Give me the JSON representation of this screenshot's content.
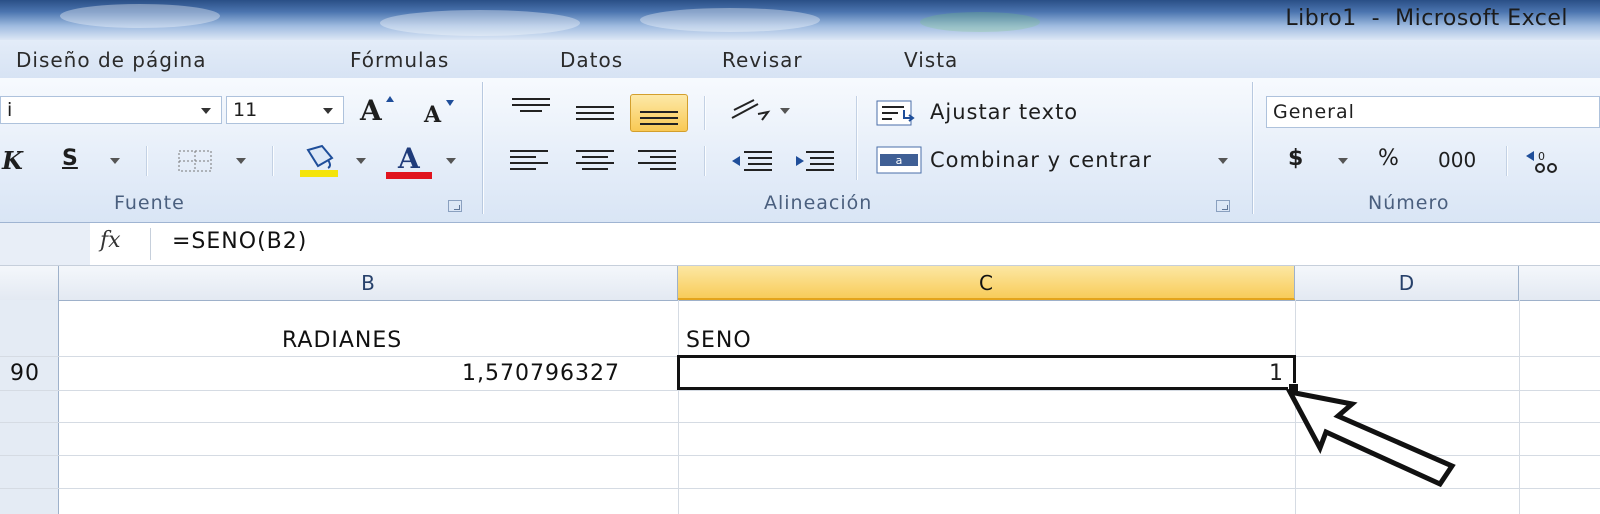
{
  "window": {
    "title": "Libro1  -  Microsoft Excel"
  },
  "tabs": [
    "Diseño de página",
    "Fórmulas",
    "Datos",
    "Revisar",
    "Vista"
  ],
  "ribbon": {
    "font_group": {
      "label": "Fuente",
      "font_name_partial": "i",
      "font_size": "11",
      "grow_label": "A",
      "shrink_label": "A",
      "italic_partial": "K",
      "underline_label": "S",
      "font_color_label": "A",
      "highlight_color": "#f4e40a",
      "font_color": "#e0141e"
    },
    "alignment_group": {
      "label": "Alineación",
      "wrap_text": "Ajustar texto",
      "merge_center": "Combinar y centrar"
    },
    "number_group": {
      "label": "Número",
      "format": "General",
      "currency": "$",
      "percent": "%",
      "thousands": "000"
    }
  },
  "formula_bar": {
    "fx_label": "fx",
    "formula": "=SENO(B2)"
  },
  "grid": {
    "columns": [
      "B",
      "C",
      "D"
    ],
    "selected_column": "C",
    "cells": {
      "b1": "RADIANES",
      "c1": "SENO",
      "a2_partial": "90",
      "b2": "1,570796327",
      "c2": "1"
    }
  },
  "colors": {
    "selected_header": "#f8cc5a",
    "ribbon_bg": "#dfe9f6",
    "title_bg": "#4c75b0"
  }
}
